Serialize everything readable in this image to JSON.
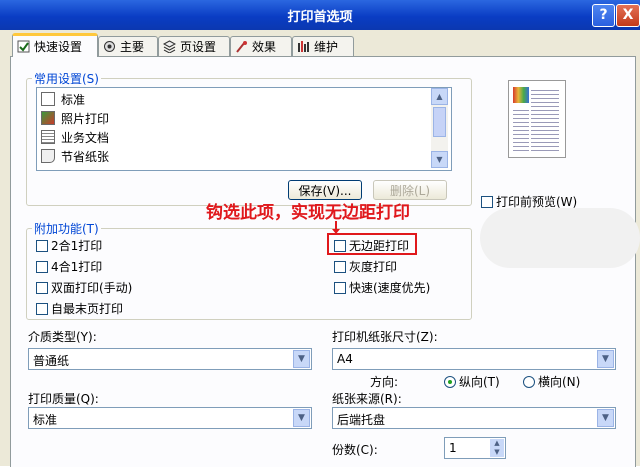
{
  "window": {
    "title": "打印首选项",
    "help_label": "?",
    "close_label": "X"
  },
  "tabs": [
    {
      "label": "快速设置",
      "icon": "quick-settings-icon",
      "active": true
    },
    {
      "label": "主要",
      "icon": "main-icon"
    },
    {
      "label": "页设置",
      "icon": "page-setup-icon"
    },
    {
      "label": "效果",
      "icon": "effects-icon"
    },
    {
      "label": "维护",
      "icon": "maintenance-icon"
    }
  ],
  "common_settings": {
    "label": "常用设置(S)",
    "items": [
      {
        "label": "标准",
        "icon": "standard-doc-icon"
      },
      {
        "label": "照片打印",
        "icon": "photo-icon"
      },
      {
        "label": "业务文档",
        "icon": "business-doc-icon"
      },
      {
        "label": "节省纸张",
        "icon": "save-paper-icon"
      }
    ],
    "save_label": "保存(V)...",
    "delete_label": "删除(L)",
    "preview_label": "打印前预览(W)"
  },
  "additional_features": {
    "label": "附加功能(T)",
    "left": [
      {
        "label": "2合1打印",
        "checked": false
      },
      {
        "label": "4合1打印",
        "checked": false
      },
      {
        "label": "双面打印(手动)",
        "checked": false
      },
      {
        "label": "自最末页打印",
        "checked": false
      }
    ],
    "right": [
      {
        "label": "无边距打印",
        "checked": false
      },
      {
        "label": "灰度打印",
        "checked": false
      },
      {
        "label": "快速(速度优先)",
        "checked": false
      }
    ]
  },
  "annotation": {
    "text": "钩选此项，实现无边距打印",
    "color": "#e0181c"
  },
  "media_type": {
    "label": "介质类型(Y):",
    "value": "普通纸"
  },
  "print_quality": {
    "label": "打印质量(Q):",
    "value": "标准"
  },
  "paper_size": {
    "label": "打印机纸张尺寸(Z):",
    "value": "A4"
  },
  "orientation": {
    "label": "方向:",
    "portrait_label": "纵向(T)",
    "landscape_label": "横向(N)",
    "selected": "portrait"
  },
  "paper_source": {
    "label": "纸张来源(R):",
    "value": "后端托盘"
  },
  "copies": {
    "label": "份数(C):",
    "value": "1"
  },
  "colors": {
    "title_bar": "#0a3dc4",
    "panel": "#ece9d8",
    "group_label": "#0046d5",
    "annotation": "#e0181c"
  }
}
